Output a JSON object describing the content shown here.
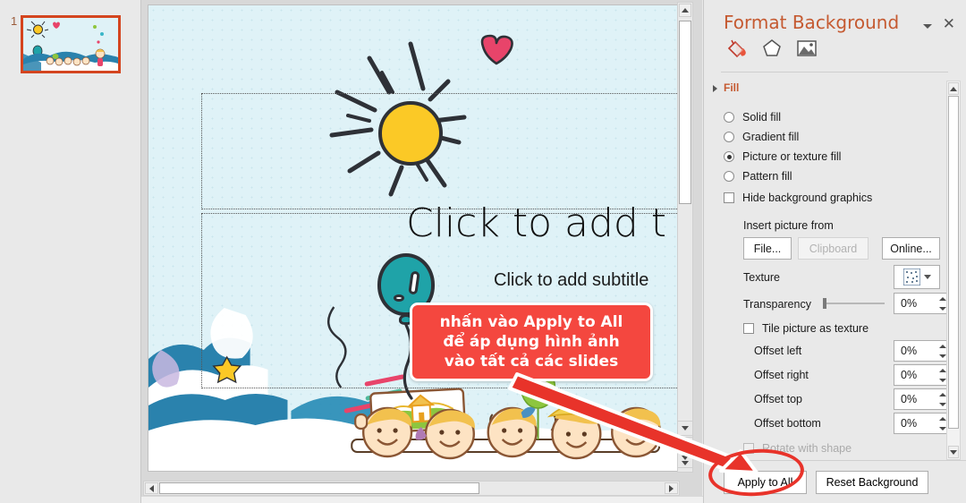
{
  "thumbnail_pane": {
    "slide_number": "1",
    "selected": true
  },
  "slide": {
    "title_placeholder": "Click to add t",
    "subtitle_placeholder": "Click to add subtitle",
    "background_color": "#dff2f7",
    "artwork": {
      "sun": "sun-illustration",
      "heart": "heart-illustration",
      "balloon": "balloon-illustration",
      "children": "children-illustration"
    }
  },
  "callout": {
    "line1": "nhấn vào Apply to All",
    "line2": "để áp dụng hình ảnh",
    "line3": "vào tất cả các slides",
    "background": "#f4473f",
    "text_color": "#ffffff"
  },
  "panel": {
    "title": "Format Background",
    "close_label": "✕",
    "tabs": [
      {
        "name": "fill-tab",
        "icon": "paint-bucket-icon",
        "active": true
      },
      {
        "name": "effects-tab",
        "icon": "pentagon-icon",
        "active": false
      },
      {
        "name": "picture-tab",
        "icon": "picture-icon",
        "active": false
      }
    ],
    "section_fill": "Fill",
    "fill_options": [
      {
        "label": "Solid fill",
        "accel": "S",
        "selected": false
      },
      {
        "label": "Gradient fill",
        "accel": "G",
        "selected": false
      },
      {
        "label": "Picture or texture fill",
        "accel": "P",
        "selected": true
      },
      {
        "label": "Pattern fill",
        "accel": "a",
        "selected": false
      }
    ],
    "hide_background_graphics": {
      "label": "Hide background graphics",
      "checked": false
    },
    "insert_picture_from": "Insert picture from",
    "insert_buttons": [
      {
        "label": "File...",
        "disabled": false
      },
      {
        "label": "Clipboard",
        "disabled": true
      },
      {
        "label": "Online...",
        "disabled": false
      }
    ],
    "texture_label": "Texture",
    "transparency_label": "Transparency",
    "transparency_value": "0%",
    "tile_picture_as_texture": {
      "label": "Tile picture as texture",
      "checked": false
    },
    "offsets": [
      {
        "label": "Offset left",
        "value": "0%"
      },
      {
        "label": "Offset right",
        "value": "0%"
      },
      {
        "label": "Offset top",
        "value": "0%"
      },
      {
        "label": "Offset bottom",
        "value": "0%"
      }
    ],
    "rotate_with_shape": {
      "label": "Rotate with shape",
      "checked": false,
      "disabled": true
    },
    "footer_buttons": {
      "apply_to_all": "Apply to All",
      "reset_background": "Reset Background"
    },
    "highlight_color": "#e8332a",
    "accent_color": "#c55a31"
  }
}
